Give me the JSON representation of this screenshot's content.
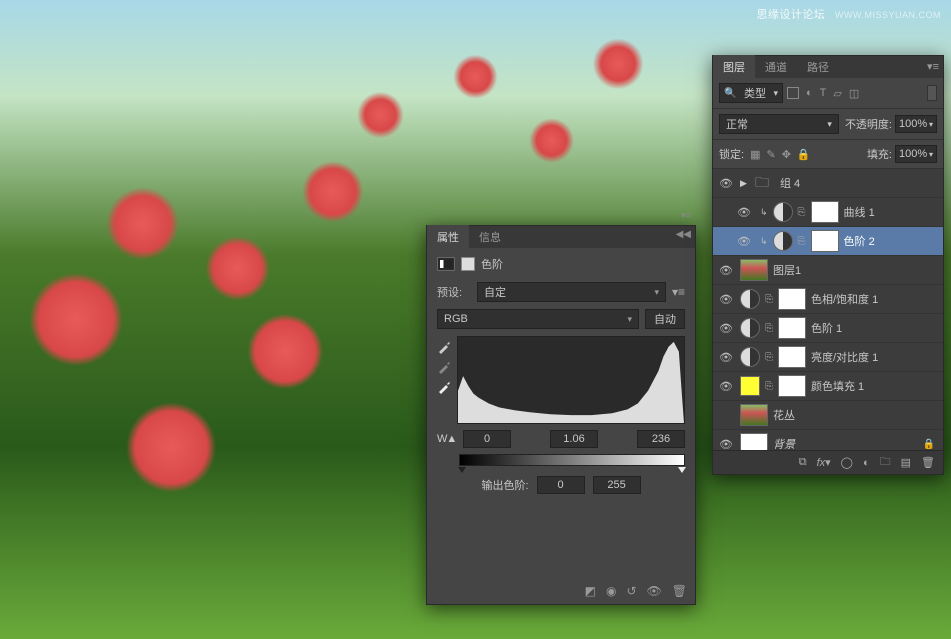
{
  "watermark": {
    "text": "思缘设计论坛",
    "site": "WWW.MISSYUAN.COM"
  },
  "properties": {
    "tabs": {
      "active": "属性",
      "other": "信息"
    },
    "adjustment_name": "色阶",
    "preset_label": "预设:",
    "preset_value": "自定",
    "channel_value": "RGB",
    "auto_label": "自动",
    "input_black": "0",
    "input_gamma": "1.06",
    "input_white": "236",
    "output_label": "输出色阶:",
    "output_black": "0",
    "output_white": "255"
  },
  "layers": {
    "tabs": {
      "active": "图层",
      "t2": "通道",
      "t3": "路径"
    },
    "filter_label": "类型",
    "blend_mode": "正常",
    "opacity_label": "不透明度:",
    "opacity_value": "100%",
    "lock_label": "锁定:",
    "fill_label": "填充:",
    "fill_value": "100%",
    "items": [
      {
        "name": "组 4",
        "kind": "group"
      },
      {
        "name": "曲线 1",
        "kind": "adj",
        "indent": true
      },
      {
        "name": "色阶 2",
        "kind": "adj",
        "indent": true,
        "selected": true
      },
      {
        "name": "图层1",
        "kind": "image"
      },
      {
        "name": "色相/饱和度 1",
        "kind": "adj"
      },
      {
        "name": "色阶 1",
        "kind": "adj"
      },
      {
        "name": "亮度/对比度 1",
        "kind": "adj"
      },
      {
        "name": "颜色填充 1",
        "kind": "fill"
      },
      {
        "name": "花丛",
        "kind": "image",
        "noeye": true
      },
      {
        "name": "背景",
        "kind": "bg",
        "italic": true
      }
    ]
  }
}
